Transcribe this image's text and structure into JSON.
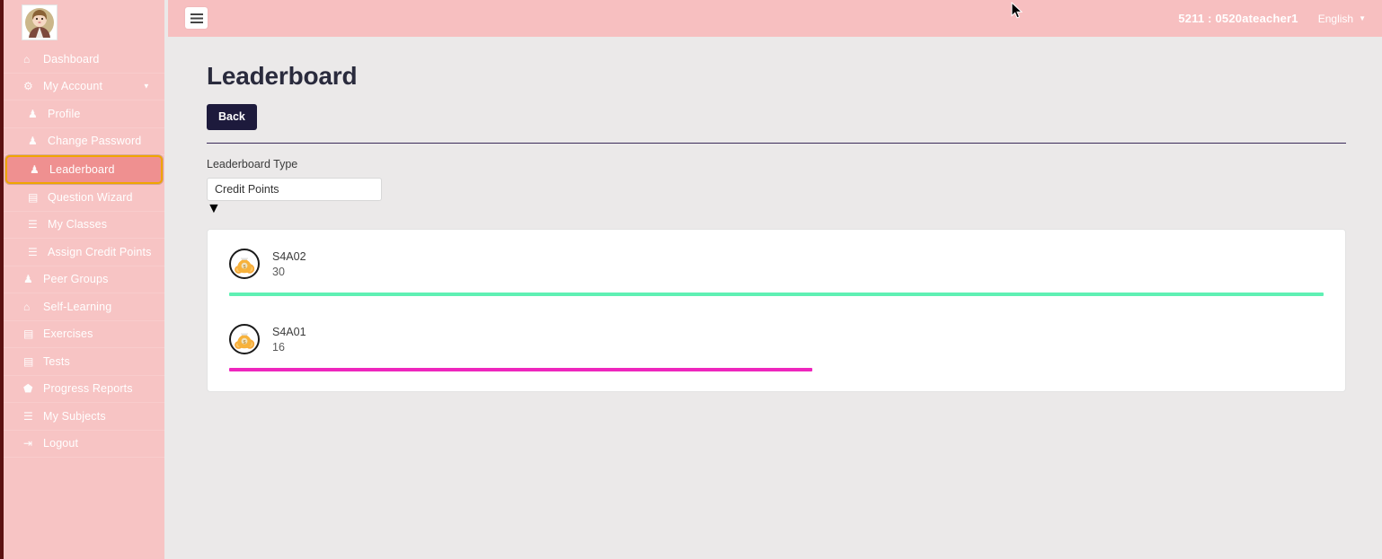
{
  "topbar": {
    "menu_icon": "hamburger-icon",
    "user_label": "5211 : 0520ateacher1",
    "language_label": "English",
    "language_caret": "▼"
  },
  "sidebar": {
    "avatar_icon": "user-avatar",
    "items": [
      {
        "label": "Dashboard",
        "icon": "home-icon",
        "glyph": "⌂",
        "sub": false,
        "active": false,
        "caret": ""
      },
      {
        "label": "My Account",
        "icon": "gear-icon",
        "glyph": "⚙",
        "sub": false,
        "active": false,
        "caret": "▼"
      },
      {
        "label": "Profile",
        "icon": "user-icon",
        "glyph": "♟",
        "sub": true,
        "active": false,
        "caret": ""
      },
      {
        "label": "Change Password",
        "icon": "user-icon",
        "glyph": "♟",
        "sub": true,
        "active": false,
        "caret": ""
      },
      {
        "label": "Leaderboard",
        "icon": "user-icon",
        "glyph": "♟",
        "sub": true,
        "active": true,
        "caret": ""
      },
      {
        "label": "Question Wizard",
        "icon": "book-icon",
        "glyph": "▤",
        "sub": true,
        "active": false,
        "caret": ""
      },
      {
        "label": "My Classes",
        "icon": "list-icon",
        "glyph": "☰",
        "sub": true,
        "active": false,
        "caret": ""
      },
      {
        "label": "Assign Credit Points",
        "icon": "list-icon",
        "glyph": "☰",
        "sub": true,
        "active": false,
        "caret": ""
      },
      {
        "label": "Peer Groups",
        "icon": "user-icon",
        "glyph": "♟",
        "sub": false,
        "active": false,
        "caret": ""
      },
      {
        "label": "Self-Learning",
        "icon": "home-icon",
        "glyph": "⌂",
        "sub": false,
        "active": false,
        "caret": ""
      },
      {
        "label": "Exercises",
        "icon": "book-icon",
        "glyph": "▤",
        "sub": false,
        "active": false,
        "caret": ""
      },
      {
        "label": "Tests",
        "icon": "book-icon",
        "glyph": "▤",
        "sub": false,
        "active": false,
        "caret": ""
      },
      {
        "label": "Progress Reports",
        "icon": "tag-icon",
        "glyph": "⬟",
        "sub": false,
        "active": false,
        "caret": ""
      },
      {
        "label": "My Subjects",
        "icon": "list-icon",
        "glyph": "☰",
        "sub": false,
        "active": false,
        "caret": ""
      },
      {
        "label": "Logout",
        "icon": "logout-icon",
        "glyph": "⇥",
        "sub": false,
        "active": false,
        "caret": ""
      }
    ]
  },
  "main": {
    "page_title": "Leaderboard",
    "back_label": "Back",
    "filter_label": "Leaderboard Type",
    "select_value": "Credit Points",
    "select_caret": "▼",
    "select_options": [
      "Credit Points"
    ],
    "leaderboard": [
      {
        "name": "S4A02",
        "score": "30",
        "bar_percent": 100,
        "bar_color": "#5ff0b4",
        "avatar_icon": "money-bag-icon"
      },
      {
        "name": "S4A01",
        "score": "16",
        "bar_percent": 53.3,
        "bar_color": "#ee26bd",
        "avatar_icon": "money-bag-icon"
      }
    ]
  },
  "colors": {
    "sidebar_bg": "#f7c4c4",
    "sidebar_active_bg": "#ef9090",
    "sidebar_active_outline": "#f0a500",
    "topbar_bg": "#f7bfc0",
    "page_bg": "#ebe9e9",
    "back_button_bg": "#1d1a3c",
    "bar_first": "#5ff0b4",
    "bar_second": "#ee26bd"
  }
}
